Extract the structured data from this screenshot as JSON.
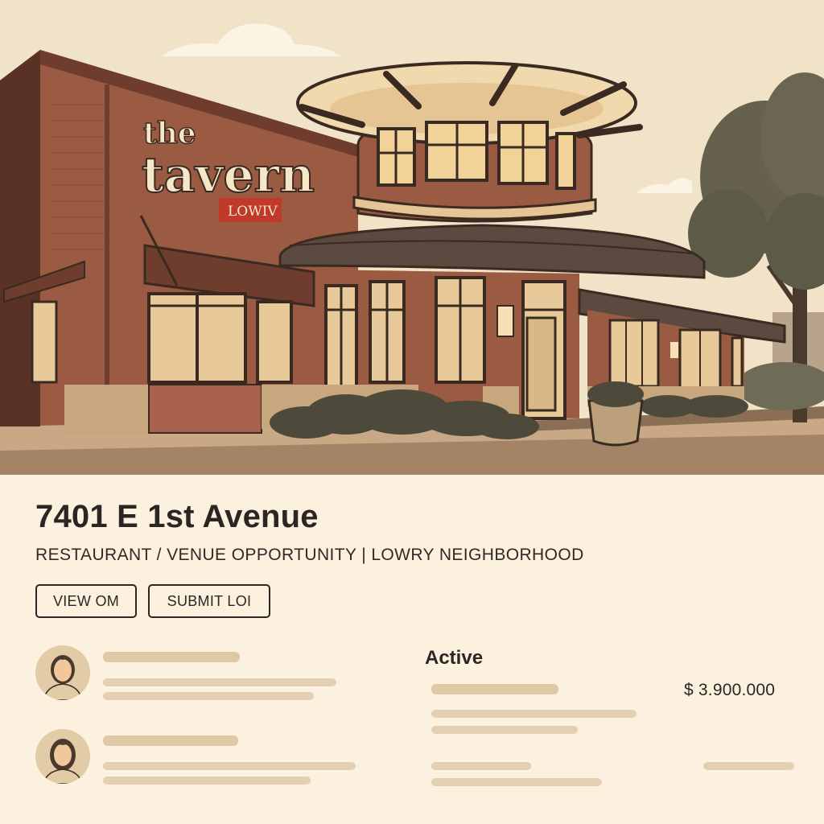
{
  "hero": {
    "sign_word1": "the",
    "sign_word2": "tavern",
    "sign_badge": "LOWIV"
  },
  "listing": {
    "title": "7401 E 1st Avenue",
    "subtitle": "RESTAURANT / VENUE OPPORTUNITY | LOWRY NEIGHBORHOOD",
    "view_om_label": "VIEW OM",
    "submit_loi_label": "SUBMIT LOI",
    "status": "Active",
    "price": "$ 3.900.000"
  },
  "colors": {
    "background": "#fcf1de",
    "sky": "#f1e3c8",
    "brick": "#9b5a42",
    "accent_red": "#c0392b",
    "text": "#2b2623",
    "placeholder_bar": "#e3d0b3"
  },
  "icons": {
    "avatar_1": "user-avatar-icon",
    "avatar_2": "user-avatar-icon"
  }
}
